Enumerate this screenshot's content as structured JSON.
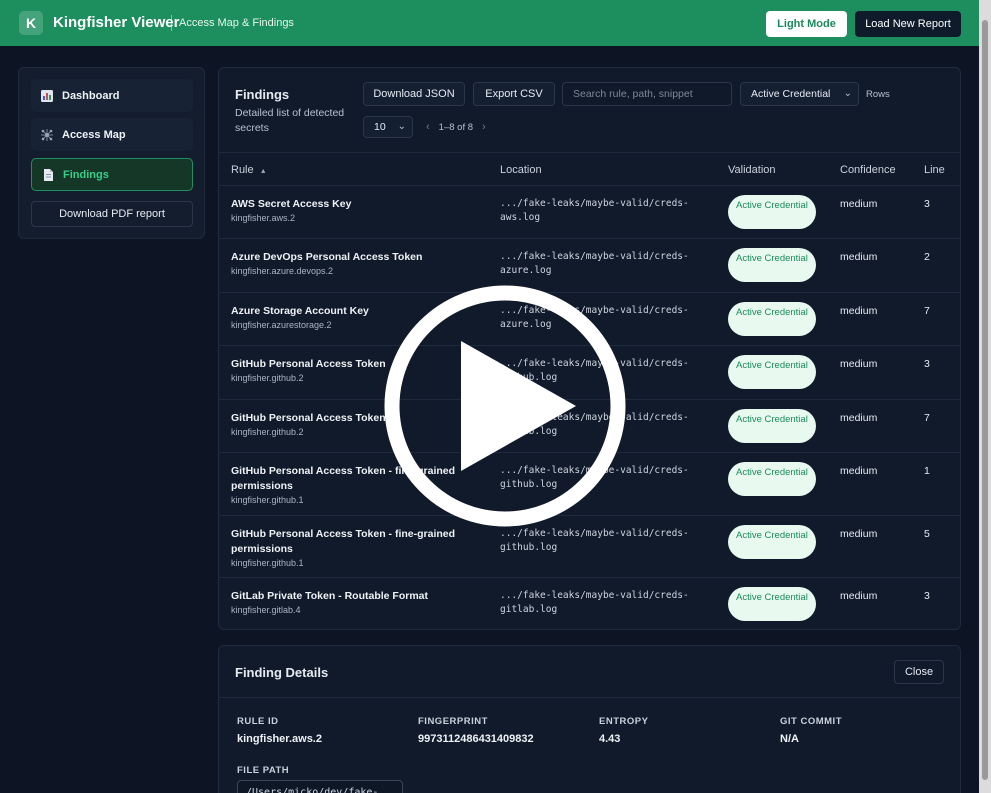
{
  "header": {
    "logo_letter": "K",
    "app_title": "Kingfisher Viewer",
    "subtitle": "Access Map & Findings",
    "light_mode_label": "Light Mode",
    "load_report_label": "Load New Report",
    "brand_color": "#1d8f5f"
  },
  "sidebar": {
    "items": [
      {
        "label": "Dashboard",
        "icon": "bar-chart-icon"
      },
      {
        "label": "Access Map",
        "icon": "network-icon"
      },
      {
        "label": "Findings",
        "icon": "document-icon",
        "active": true
      }
    ],
    "pdf_label": "Download PDF report"
  },
  "findings": {
    "title": "Findings",
    "description": "Detailed list of detected secrets",
    "download_json_label": "Download JSON",
    "export_csv_label": "Export CSV",
    "search_placeholder": "Search rule, path, snippet",
    "filter_value": "Active Credential",
    "rows_label": "Rows",
    "page_size": "10",
    "page_range": "1–8 of 8",
    "columns": {
      "rule": "Rule",
      "location": "Location",
      "validation": "Validation",
      "confidence": "Confidence",
      "line": "Line"
    },
    "sort_indicator": "▲",
    "rows": [
      {
        "name": "AWS Secret Access Key",
        "id": "kingfisher.aws.2",
        "loc": ".../fake-leaks/maybe-valid/creds-\naws.log",
        "validation": "Active Credential",
        "confidence": "medium",
        "line": "3"
      },
      {
        "name": "Azure DevOps Personal Access Token",
        "id": "kingfisher.azure.devops.2",
        "loc": ".../fake-leaks/maybe-valid/creds-\nazure.log",
        "validation": "Active Credential",
        "confidence": "medium",
        "line": "2"
      },
      {
        "name": "Azure Storage Account Key",
        "id": "kingfisher.azurestorage.2",
        "loc": ".../fake-leaks/maybe-valid/creds-\nazure.log",
        "validation": "Active Credential",
        "confidence": "medium",
        "line": "7"
      },
      {
        "name": "GitHub Personal Access Token",
        "id": "kingfisher.github.2",
        "loc": ".../fake-leaks/maybe-valid/creds-\ngithub.log",
        "validation": "Active Credential",
        "confidence": "medium",
        "line": "3"
      },
      {
        "name": "GitHub Personal Access Token",
        "id": "kingfisher.github.2",
        "loc": ".../fake-leaks/maybe-valid/creds-\ngithub.log",
        "validation": "Active Credential",
        "confidence": "medium",
        "line": "7"
      },
      {
        "name": "GitHub Personal Access Token - fine-grained permissions",
        "id": "kingfisher.github.1",
        "loc": ".../fake-leaks/maybe-valid/creds-\ngithub.log",
        "validation": "Active Credential",
        "confidence": "medium",
        "line": "1"
      },
      {
        "name": "GitHub Personal Access Token - fine-grained permissions",
        "id": "kingfisher.github.1",
        "loc": ".../fake-leaks/maybe-valid/creds-\ngithub.log",
        "validation": "Active Credential",
        "confidence": "medium",
        "line": "5"
      },
      {
        "name": "GitLab Private Token - Routable Format",
        "id": "kingfisher.gitlab.4",
        "loc": ".../fake-leaks/maybe-valid/creds-\ngitlab.log",
        "validation": "Active Credential",
        "confidence": "medium",
        "line": "3"
      }
    ]
  },
  "details": {
    "title": "Finding Details",
    "close_label": "Close",
    "fields": [
      {
        "label": "RULE ID",
        "value": "kingfisher.aws.2"
      },
      {
        "label": "FINGERPRINT",
        "value": "9973112486431409832"
      },
      {
        "label": "ENTROPY",
        "value": "4.43"
      },
      {
        "label": "GIT COMMIT",
        "value": "N/A"
      }
    ],
    "file_path_label": "FILE PATH",
    "file_path_value": "/Users/micko/dev/fake-"
  }
}
